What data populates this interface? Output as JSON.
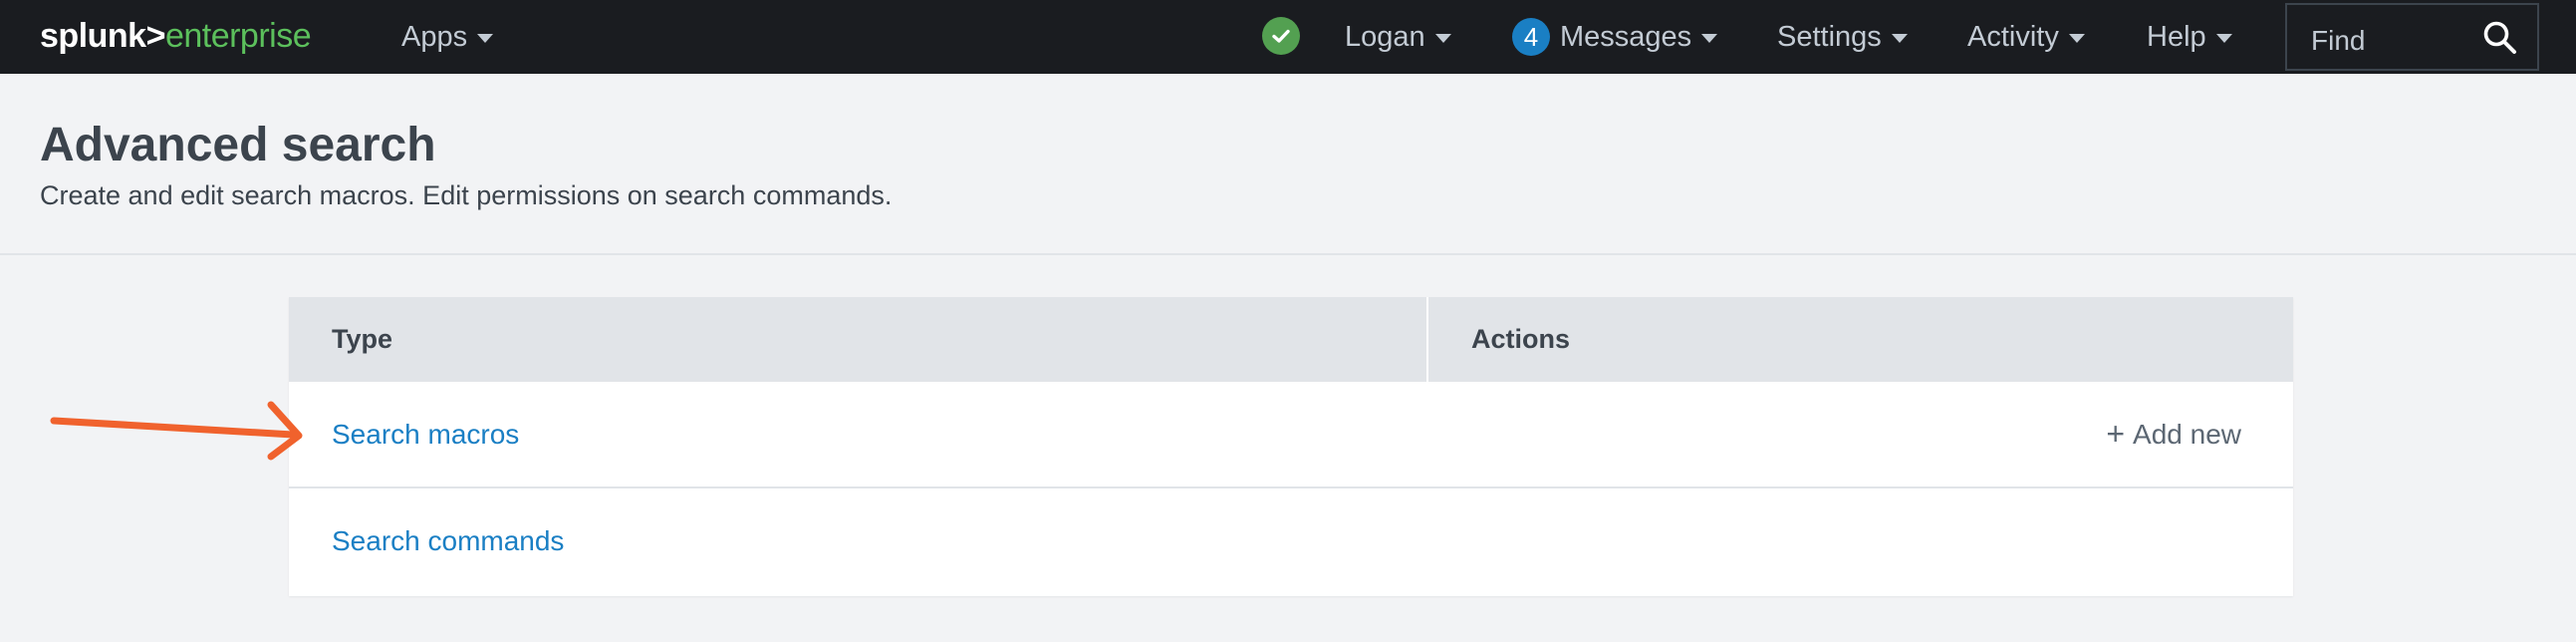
{
  "topbar": {
    "logo_part1": "splunk>",
    "logo_part2": "enterprise",
    "apps_label": "Apps",
    "user_label": "Logan",
    "messages_count": "4",
    "messages_label": "Messages",
    "settings_label": "Settings",
    "activity_label": "Activity",
    "help_label": "Help",
    "find_placeholder": "Find",
    "status_color": "#53a051",
    "badge_color": "#1a7fc4",
    "icons": [
      "check-circle-icon",
      "search-icon",
      "caret-down-icon"
    ]
  },
  "page": {
    "title": "Advanced search",
    "description": "Create and edit search macros. Edit permissions on search commands."
  },
  "table": {
    "columns": [
      "Type",
      "Actions"
    ],
    "rows": [
      {
        "type": "Search macros",
        "action": "Add new"
      },
      {
        "type": "Search commands",
        "action": ""
      }
    ],
    "link_color": "#1a7fc4"
  },
  "annotation": {
    "arrow_color": "#f0622d",
    "icon": "arrow-right-icon"
  }
}
